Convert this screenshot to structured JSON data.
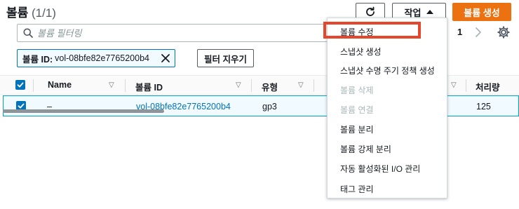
{
  "header": {
    "title": "볼륨",
    "count": "(1/1)",
    "actions_label": "작업",
    "create_label": "볼륨 생성"
  },
  "search": {
    "placeholder": "볼륨 필터링"
  },
  "pagination": {
    "current_page": "1"
  },
  "filter": {
    "token_label": "볼륨 ID:",
    "token_value": "vol-08bfe82e7765200b4",
    "clear_label": "필터 지우기"
  },
  "table": {
    "columns": [
      "Name",
      "볼륨 ID",
      "유형",
      "처리량"
    ],
    "rows": [
      {
        "name": "–",
        "volume_id": "vol-08bfe82e7765200b4",
        "type": "gp3",
        "throughput": "125",
        "selected": true
      }
    ]
  },
  "actions_menu": {
    "items": [
      {
        "label": "볼륨 수정",
        "enabled": true,
        "highlighted": true
      },
      {
        "label": "스냅샷 생성",
        "enabled": true
      },
      {
        "label": "스냅샷 수명 주기 정책 생성",
        "enabled": true
      },
      {
        "label": "볼륨 삭제",
        "enabled": false
      },
      {
        "label": "볼륨 연결",
        "enabled": false
      },
      {
        "label": "볼륨 분리",
        "enabled": true
      },
      {
        "label": "볼륨 강제 분리",
        "enabled": true
      },
      {
        "label": "자동 활성화된 I/O 관리",
        "enabled": true
      },
      {
        "label": "태그 관리",
        "enabled": true
      }
    ]
  },
  "colors": {
    "primary": "#ec7211",
    "link": "#0073bb",
    "highlight_border": "#e4472b",
    "selected_row_bg": "#f1faff"
  },
  "icons": [
    "refresh-icon",
    "caret-down-icon",
    "search-icon",
    "chevron-right-icon",
    "gear-icon",
    "close-icon",
    "sort-icon",
    "checkbox-checked-icon"
  ]
}
